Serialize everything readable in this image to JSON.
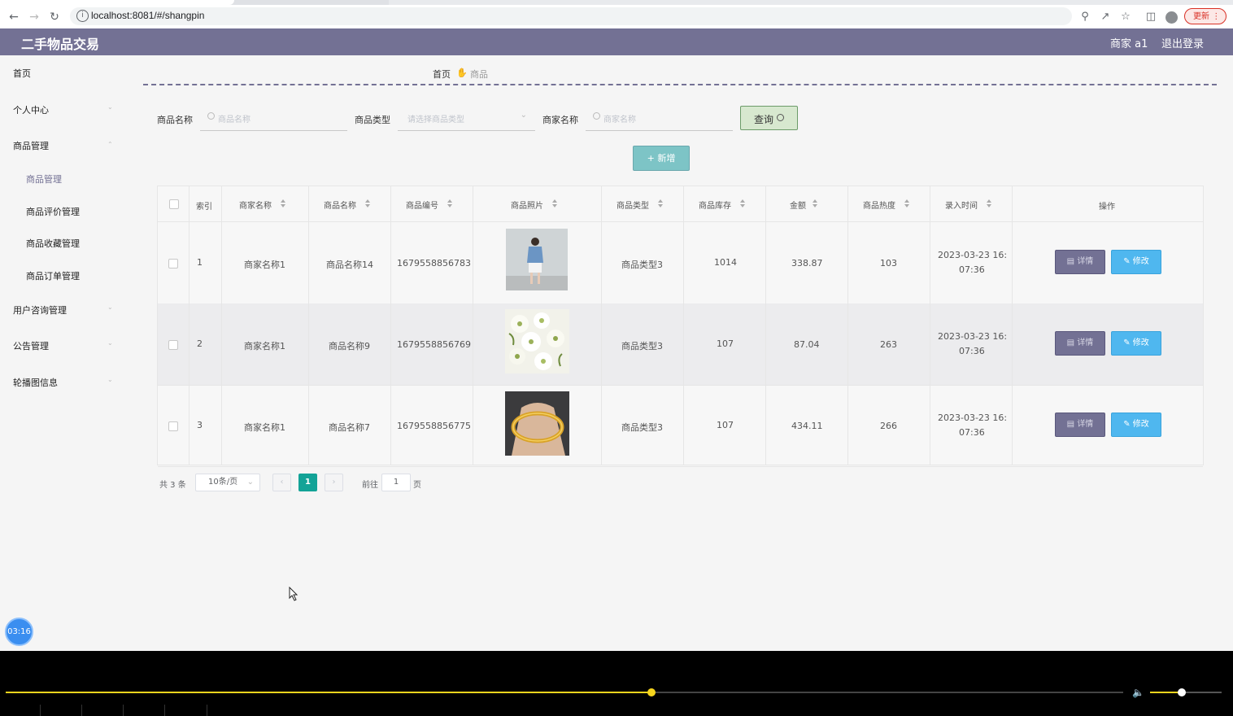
{
  "browser": {
    "url": "localhost:8081/#/shangpin",
    "update_label": "更新"
  },
  "header": {
    "title": "二手物品交易",
    "user": "商家 a1",
    "logout": "退出登录"
  },
  "sidebar": {
    "items": [
      {
        "label": "首页"
      },
      {
        "label": "个人中心"
      },
      {
        "label": "商品管理"
      },
      {
        "label": "商品管理"
      },
      {
        "label": "商品评价管理"
      },
      {
        "label": "商品收藏管理"
      },
      {
        "label": "商品订单管理"
      },
      {
        "label": "用户咨询管理"
      },
      {
        "label": "公告管理"
      },
      {
        "label": "轮播图信息"
      }
    ]
  },
  "breadcrumb": {
    "home": "首页",
    "current": "商品"
  },
  "search": {
    "name_label": "商品名称",
    "name_placeholder": "商品名称",
    "type_label": "商品类型",
    "type_placeholder": "请选择商品类型",
    "merchant_label": "商家名称",
    "merchant_placeholder": "商家名称",
    "query_button": "查询"
  },
  "add_button": "新增",
  "table": {
    "headers": [
      "索引",
      "商家名称",
      "商品名称",
      "商品编号",
      "商品照片",
      "商品类型",
      "商品库存",
      "金额",
      "商品热度",
      "录入时间",
      "操作"
    ],
    "rows": [
      {
        "index": "1",
        "merchant": "商家名称1",
        "name": "商品名称14",
        "code": "1679558856783",
        "photo": "woman-in-denim-jacket-photo",
        "type": "商品类型3",
        "stock": "1014",
        "price": "338.87",
        "heat": "103",
        "time_date": "2023-03-23 16:",
        "time_clock": "07:36"
      },
      {
        "index": "2",
        "merchant": "商家名称1",
        "name": "商品名称9",
        "code": "1679558856769",
        "photo": "white-flowers-photo",
        "type": "商品类型3",
        "stock": "107",
        "price": "87.04",
        "heat": "263",
        "time_date": "2023-03-23 16:",
        "time_clock": "07:36"
      },
      {
        "index": "3",
        "merchant": "商家名称1",
        "name": "商品名称7",
        "code": "1679558856775",
        "photo": "gold-bangle-in-hand-photo",
        "type": "商品类型3",
        "stock": "107",
        "price": "434.11",
        "heat": "266",
        "time_date": "2023-03-23 16:",
        "time_clock": "07:36"
      }
    ],
    "detail_label": "详情",
    "edit_label": "修改"
  },
  "pagination": {
    "total": "共 3 条",
    "page_size": "10条/页",
    "current": "1",
    "goto_prefix": "前往",
    "goto_value": "1",
    "goto_suffix": "页"
  },
  "timer": "03:16",
  "colors": {
    "header": "#737194",
    "accent": "#13a397",
    "edit": "#4fb7ef",
    "progress": "#f7d51d"
  },
  "player": {
    "progress_fraction": 0.578,
    "volume_fraction": 0.44
  }
}
